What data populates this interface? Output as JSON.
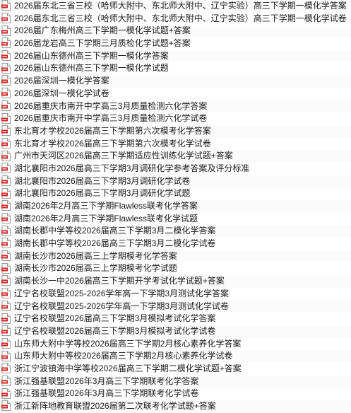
{
  "icon_name": "pdf-file-icon",
  "colors": {
    "pdf_red": "#d42020",
    "page": "#ffffff",
    "text": "#1a1a1a"
  },
  "files": [
    "2026届东北三省三校（哈师大附中、东北师大附中、辽宁实验）高三下学期一模化学答案",
    "2026届东北三省三校（哈师大附中、东北师大附中、辽宁实验）高三下学期一模化学试卷",
    "2026届广东梅州高三下学期一模化学试题+答案",
    "2026届龙岩高三下学期三月质检化学试题+答案",
    "2026届山东德州高三下学期一模化学答案",
    "2026届山东德州高三下学期一模化学试题",
    "2026届深圳一模化学答案",
    "2026届深圳一模化学试卷",
    "2026届重庆市南开中学高三3月质量检测六化学答案",
    "2026届重庆市南开中学高三3月质量检测六化学试卷",
    "东北育才学校2026届高三下学期第六次模考化学答案",
    "东北育才学校2026届高三下学期第六次模考化学试卷",
    "广州市天河区2026届高三下学期适应性训练化学试题+答案",
    "湖北襄阳市2026届高三下学期3月调研化学参考答案及评分标准",
    "湖北襄阳市2026届高三下学期3月调研化学试卷",
    "湖北襄阳市2026届高三下学期3月调研化学试题",
    "湖南2026年2月高三下学期Flawless联考化学答案",
    "湖南2026年2月高三下学期Flawless联考化学试题",
    "湖南长郡中学等校2026届高三下学期3月二模化学答案",
    "湖南长郡中学等校2026届高三下学期3月二模化学试卷",
    "湖南长沙市2026届高三上学期模考化学答案",
    "湖南长沙市2026届高三上学期模考化学试题",
    "湖南长沙一中2026届高三下学期开学考试化学试题+答案",
    "辽宁名校联盟2025-2026学年高一下学期3月测试化学答案",
    "辽宁名校联盟2025-2026学年高一下学期3月测试化学试卷",
    "辽宁名校联盟2026届高三下学期3月模拟考试化学答案",
    "辽宁名校联盟2026届高三下学期3月模拟考试化学试卷",
    "山东师大附中学等校2026届高三下学期2月核心素养化学答案",
    "山东师大附中等校2026届高三下学期2月核心素养化学试卷",
    "浙江宁波镇海中学等校2026届高三下学期二模化学试题+答案",
    "浙江强基联盟2026年3月高三下学期联考化学答案",
    "浙江强基联盟2026年3月高三下学期联考化学试卷",
    "浙江新阵地教育联盟2026届第二次联考化学试题+答案"
  ]
}
